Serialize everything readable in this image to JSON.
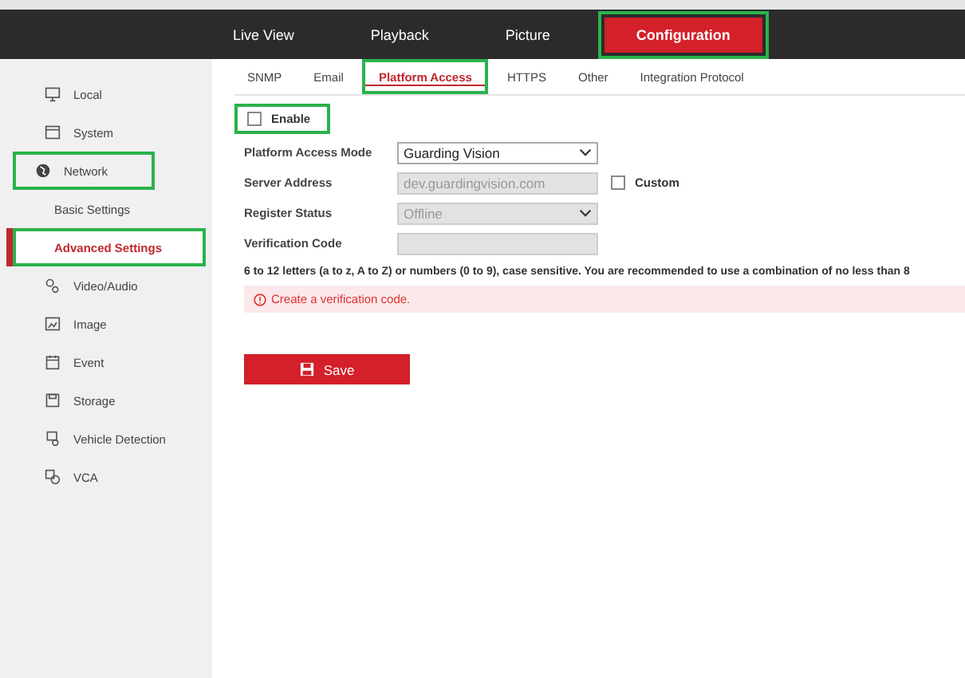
{
  "nav": [
    {
      "label": "Live View",
      "selected": false,
      "highlighted": false
    },
    {
      "label": "Playback",
      "selected": false,
      "highlighted": false
    },
    {
      "label": "Picture",
      "selected": false,
      "highlighted": false
    },
    {
      "label": "Configuration",
      "selected": true,
      "highlighted": true
    }
  ],
  "sidebar": {
    "items": [
      {
        "label": "Local",
        "selected": false,
        "highlighted": false
      },
      {
        "label": "System",
        "selected": false,
        "highlighted": false
      },
      {
        "label": "Network",
        "selected": false,
        "highlighted": true,
        "children": [
          {
            "label": "Basic Settings",
            "selected": false,
            "highlighted": false
          },
          {
            "label": "Advanced Settings",
            "selected": true,
            "highlighted": true
          }
        ]
      },
      {
        "label": "Video/Audio",
        "selected": false,
        "highlighted": false
      },
      {
        "label": "Image",
        "selected": false,
        "highlighted": false
      },
      {
        "label": "Event",
        "selected": false,
        "highlighted": false
      },
      {
        "label": "Storage",
        "selected": false,
        "highlighted": false
      },
      {
        "label": "Vehicle Detection",
        "selected": false,
        "highlighted": false
      },
      {
        "label": "VCA",
        "selected": false,
        "highlighted": false
      }
    ]
  },
  "tabs": [
    {
      "label": "SNMP",
      "selected": false,
      "highlighted": false
    },
    {
      "label": "Email",
      "selected": false,
      "highlighted": false
    },
    {
      "label": "Platform Access",
      "selected": true,
      "highlighted": true
    },
    {
      "label": "HTTPS",
      "selected": false,
      "highlighted": false
    },
    {
      "label": "Other",
      "selected": false,
      "highlighted": false
    },
    {
      "label": "Integration Protocol",
      "selected": false,
      "highlighted": false
    }
  ],
  "enable": {
    "label": "Enable",
    "checked": false,
    "highlighted": true
  },
  "fields": [
    {
      "label": "Platform Access Mode",
      "kind": "select",
      "value": "Guarding Vision",
      "disabled": false
    },
    {
      "label": "Server Address",
      "kind": "text",
      "value": "dev.guardingvision.com",
      "disabled": true,
      "option": {
        "label": "Custom",
        "checked": false
      }
    },
    {
      "label": "Register Status",
      "kind": "select",
      "value": "Offline",
      "disabled": true
    },
    {
      "label": "Verification Code",
      "kind": "text",
      "disabled": true
    }
  ],
  "hint": "6 to 12 letters (a to z, A to Z) or numbers (0 to 9), case sensitive. You are recommended to use a combination of no less than 8",
  "error": "Create a verification code.",
  "save_button": "Save"
}
